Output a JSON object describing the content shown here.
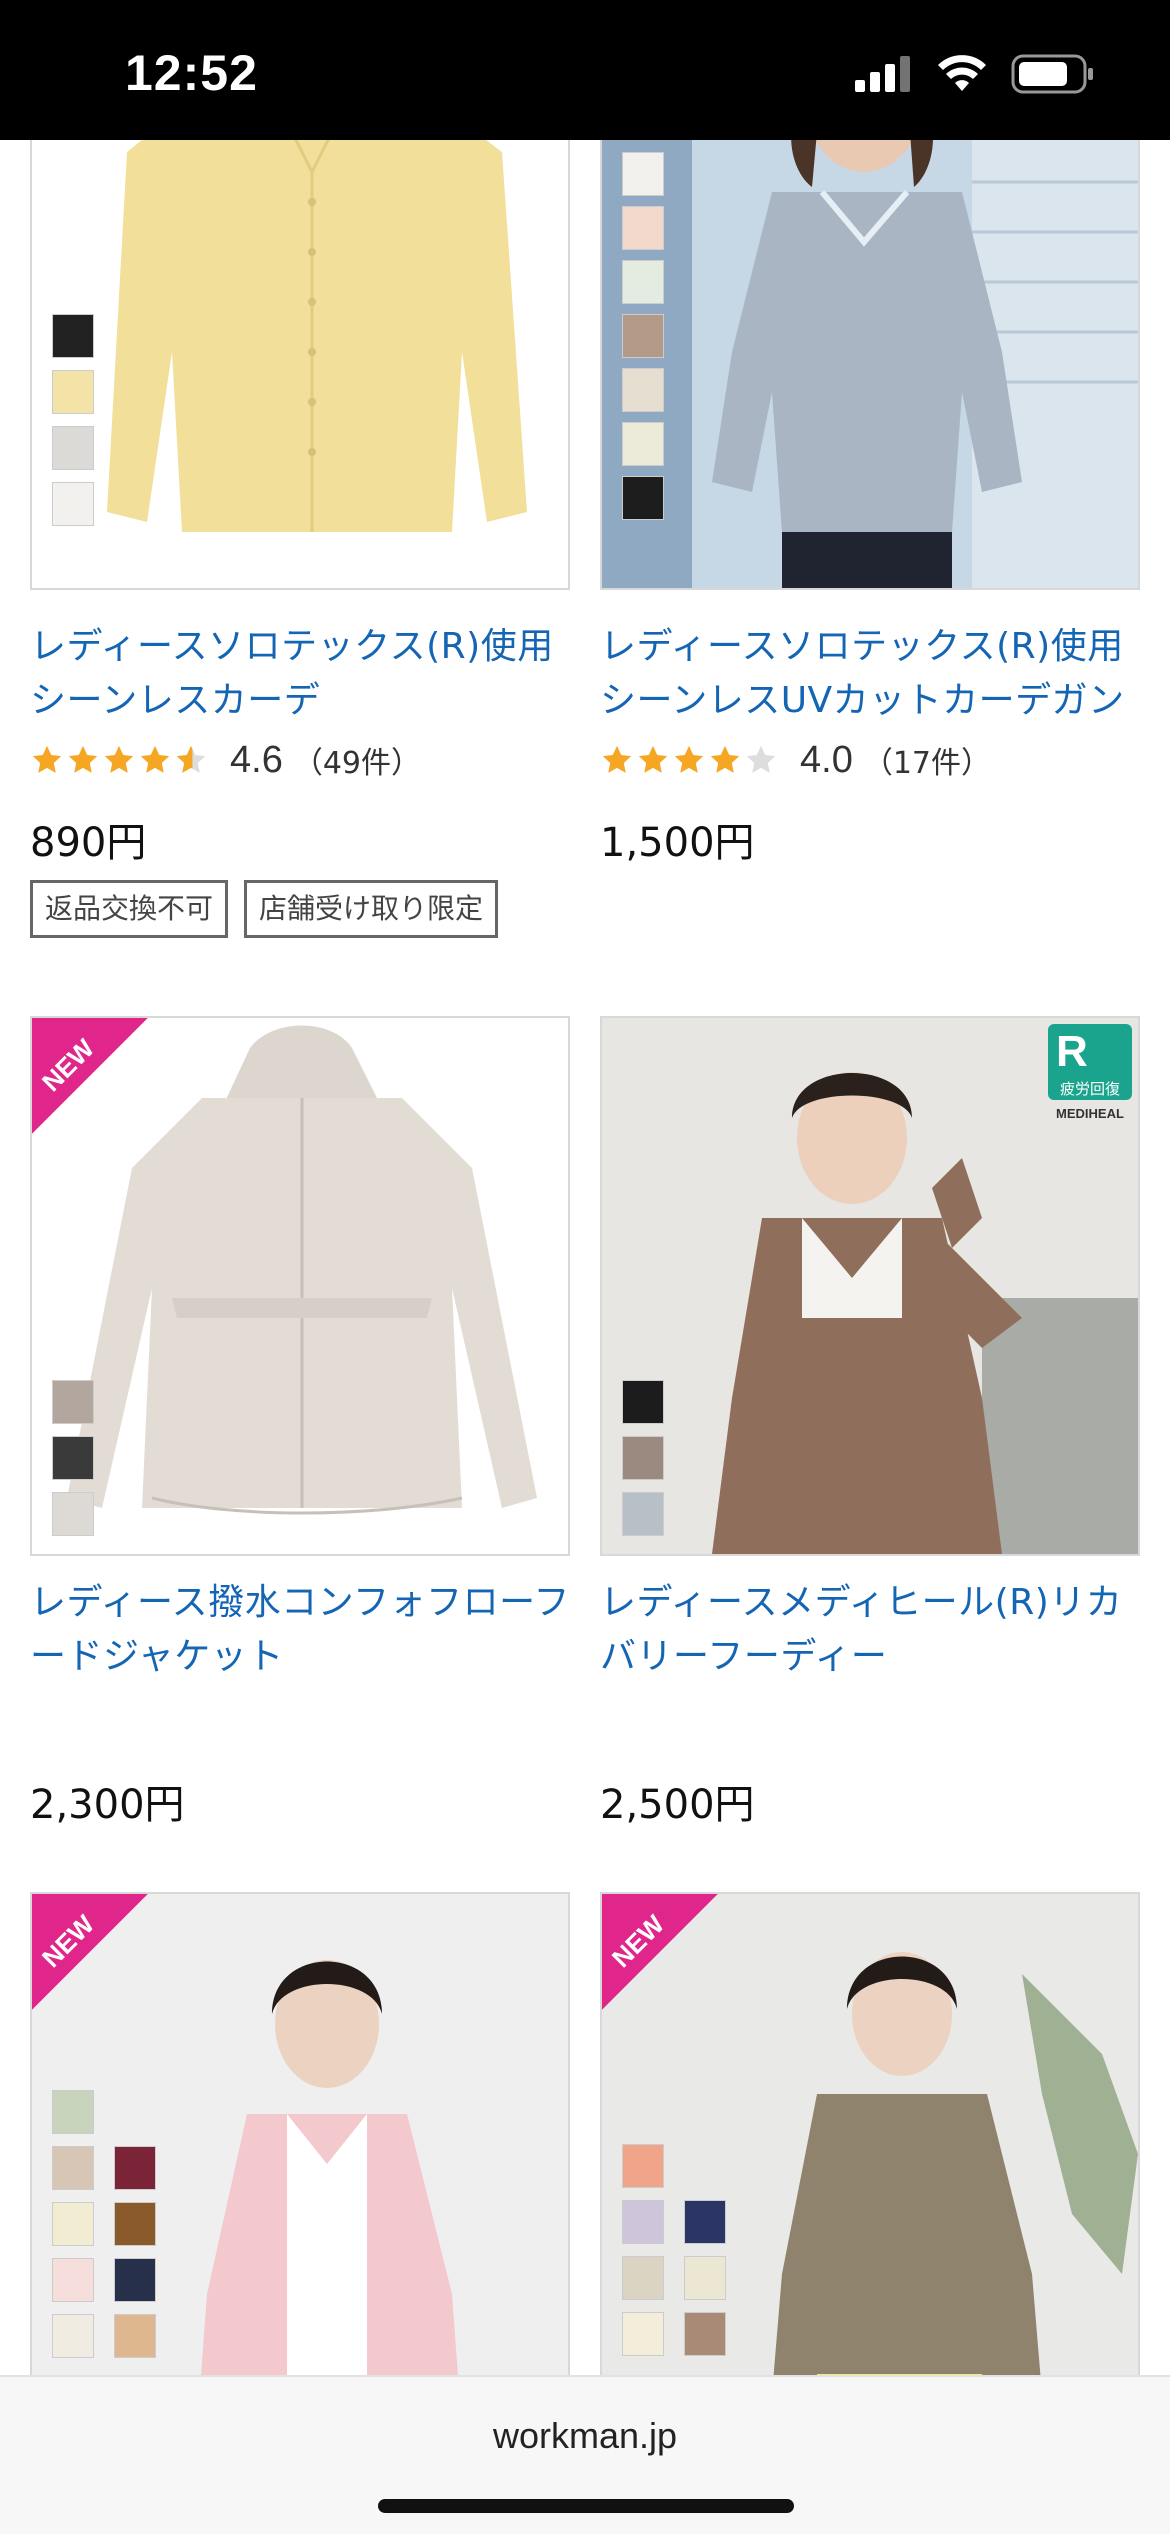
{
  "status_bar": {
    "time": "12:52"
  },
  "products": [
    {
      "title_line1": "レディースソロテックス(R)使用",
      "title_line2": "シーンレスカーデ",
      "rating": "4.6",
      "review_count": "（49件）",
      "stars_value": 4.6,
      "price": "890円",
      "tags": [
        "返品交換不可",
        "店舗受け取り限定"
      ],
      "swatches": [
        "#222222",
        "#f3e3a6",
        "#dcdad6",
        "#f2f1ee"
      ]
    },
    {
      "title_line1": "レディースソロテックス(R)使用",
      "title_line2": "シーンレスUVカットカーデガン",
      "rating": "4.0",
      "review_count": "（17件）",
      "stars_value": 4.0,
      "price": "1,500円",
      "swatches": [
        "#f2f0ec",
        "#f3d9cc",
        "#e4ece1",
        "#b39a88",
        "#e6dfd1",
        "#ecebd9",
        "#1d1d1d"
      ]
    },
    {
      "title_line1": "レディース撥水コンフォフローフ",
      "title_line2": "ードジャケット",
      "price": "2,300円",
      "badge": "NEW",
      "swatches": [
        "#b2a69e",
        "#3a3a3a",
        "#dddad6"
      ]
    },
    {
      "title_line1": "レディースメディヒール(R)リカ",
      "title_line2": "バリーフーディー",
      "price": "2,500円",
      "brand_badge_label": "疲労回復",
      "brand_badge_logo": "MEDIHEAL",
      "swatches": [
        "#1c1c1c",
        "#9b8a80",
        "#b7c0c7"
      ]
    },
    {
      "badge": "NEW",
      "swatches_col1": [
        "#c9d4bd",
        "#d7c5b6",
        "#f1ecd2",
        "#f6dedc",
        "#f1ece2"
      ],
      "swatches_col2": [
        "#7b2337",
        "#8b5a2b",
        "#27304a",
        "#deb78e"
      ]
    },
    {
      "badge": "NEW",
      "swatches_col1": [
        "#f0a48a",
        "#cfc5db",
        "#dcd4c3",
        "#f3eed9"
      ],
      "swatches_col2": [
        "#2b3566",
        "#ece7d2",
        "#a98a77"
      ]
    }
  ],
  "bottom_bar": {
    "url": "workman.jp"
  },
  "colors": {
    "link": "#1565b5",
    "star": "#f5a623",
    "new_badge": "#e0268a"
  }
}
